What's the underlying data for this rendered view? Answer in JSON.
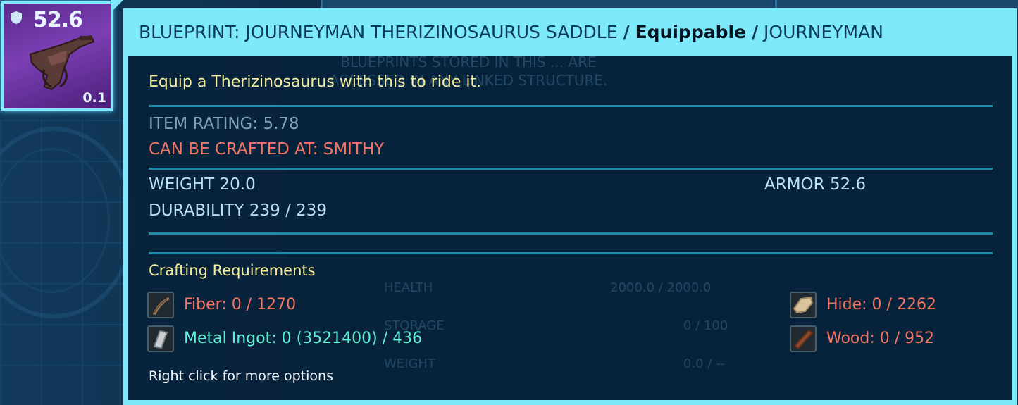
{
  "item_slot": {
    "armor_value": "52.6",
    "weight_value": "0.1",
    "colors": {
      "background": "#7b3fb3",
      "border": "#7fe8ff"
    },
    "icon": "saddle-icon"
  },
  "tooltip": {
    "title_name": "BLUEPRINT: JOURNEYMAN THERIZINOSAURUS SADDLE",
    "separator": "/",
    "category": "Equippable",
    "tier": "JOURNEYMAN",
    "description": "Equip a Therizinosaurus with this to ride it.",
    "item_rating": "ITEM RATING: 5.78",
    "crafted_at": "CAN BE CRAFTED AT: SMITHY",
    "weight": "WEIGHT 20.0",
    "armor": "ARMOR 52.6",
    "durability": "DURABILITY 239 / 239",
    "crafting_title": "Crafting Requirements",
    "requirements": [
      {
        "label": "Fiber: 0 / 1270",
        "icon": "fiber-icon",
        "color": "#f47463"
      },
      {
        "label": "Metal Ingot: 0 (3521400) / 436",
        "icon": "metal-ingot-icon",
        "color": "#5ff0d6"
      },
      {
        "label": "Hide: 0 / 2262",
        "icon": "hide-icon",
        "color": "#f47463"
      },
      {
        "label": "Wood: 0 / 952",
        "icon": "wood-icon",
        "color": "#f47463"
      }
    ],
    "hint": "Right click for more options",
    "colors": {
      "header": "#7ee9fb",
      "description": "#f5ee9c",
      "missing": "#f47463",
      "available": "#5ff0d6",
      "stats": "#b9dff3"
    }
  },
  "background": {
    "ghost_text": "BLUEPRINTS STORED IN THIS ... ARE ACCESSED IN ANY LINKED STRUCTURE.",
    "ghost_rows": [
      {
        "label": "HEALTH",
        "value": "2000.0 / 2000.0"
      },
      {
        "label": "STORAGE",
        "value": "0 / 100"
      },
      {
        "label": "WEIGHT",
        "value": "0.0 / --"
      }
    ]
  }
}
